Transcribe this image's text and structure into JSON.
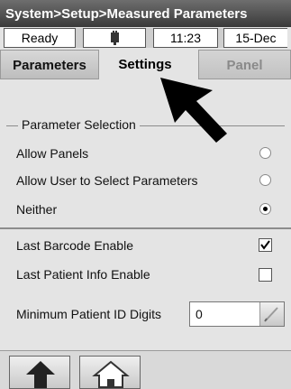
{
  "title_bar": {
    "text": "System>Setup>Measured Parameters"
  },
  "status_bar": {
    "status": "Ready",
    "icon": "battery-plug-icon",
    "time": "11:23",
    "date": "15-Dec"
  },
  "tabs": [
    {
      "label": "Parameters",
      "state": "inactive"
    },
    {
      "label": "Settings",
      "state": "active"
    },
    {
      "label": "Panel",
      "state": "disabled"
    }
  ],
  "parameter_selection": {
    "legend": "Parameter Selection",
    "options": [
      {
        "label": "Allow Panels",
        "selected": false
      },
      {
        "label": "Allow User to Select Parameters",
        "selected": false
      },
      {
        "label": "Neither",
        "selected": true
      }
    ]
  },
  "checkboxes": [
    {
      "label": "Last Barcode Enable",
      "checked": true
    },
    {
      "label": "Last Patient Info Enable",
      "checked": false
    }
  ],
  "min_patient_id": {
    "label": "Minimum Patient ID Digits",
    "value": "0"
  },
  "bottom_nav": [
    {
      "name": "up-arrow-icon"
    },
    {
      "name": "home-icon"
    }
  ],
  "colors": {
    "title_bar": "#3a3a3a",
    "background": "#e4e4e4",
    "disabled_text": "#8a8a8a"
  }
}
